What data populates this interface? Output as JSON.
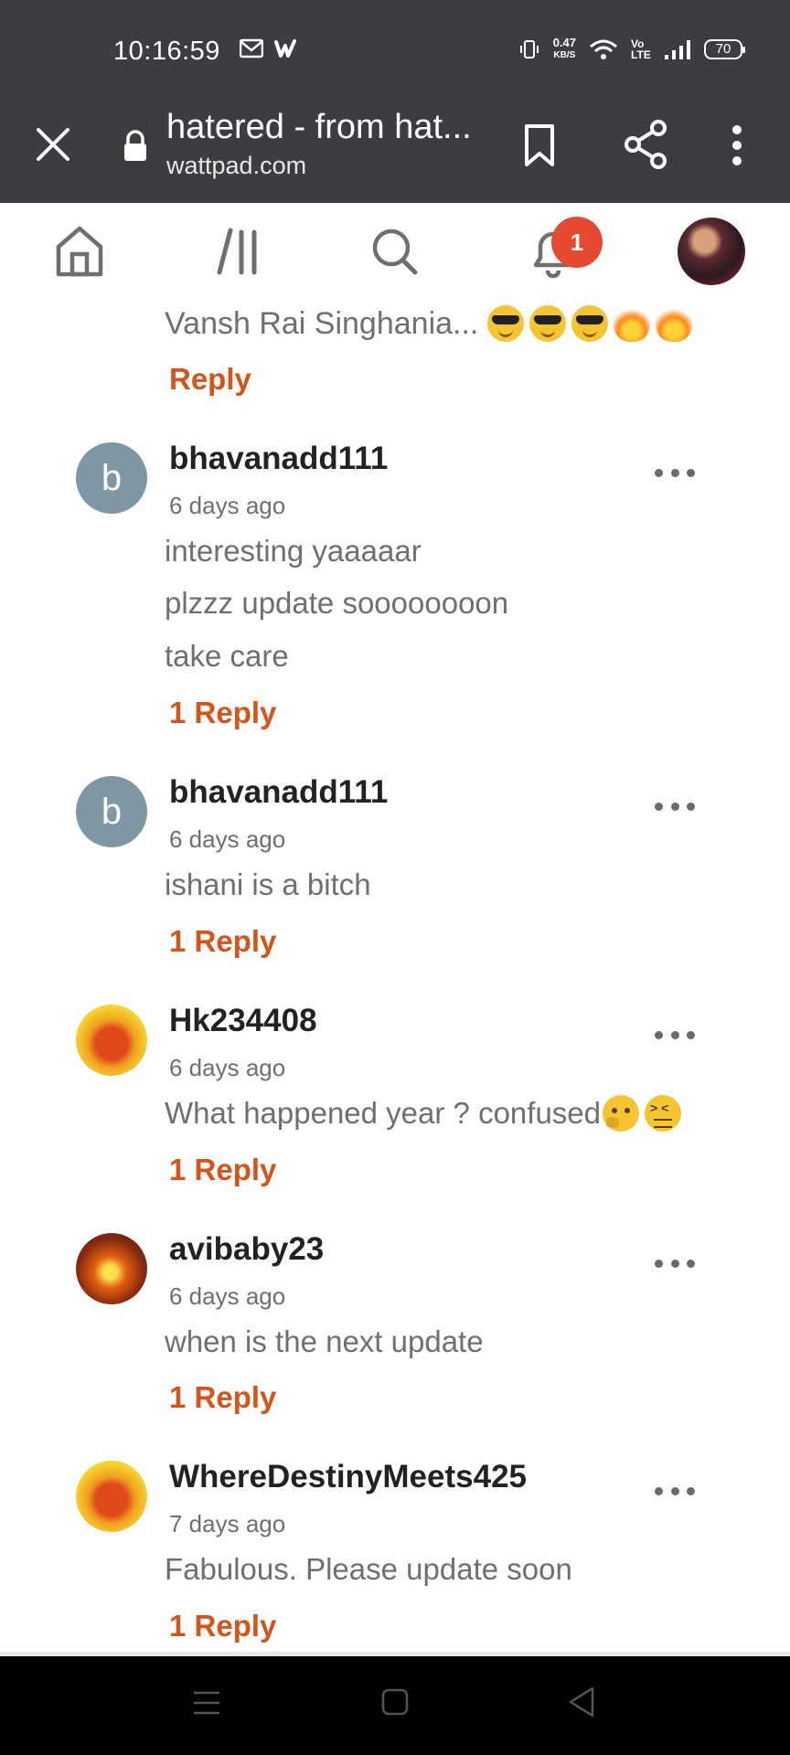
{
  "status_bar": {
    "time": "10:16:59",
    "net_speed_value": "0.47",
    "net_speed_unit": "KB/S",
    "volte": "Vo LTE",
    "battery": "70"
  },
  "browser": {
    "title": "hatered - from hat...",
    "url": "wattpad.com"
  },
  "app_nav": {
    "notification_count": "1"
  },
  "partial_comment": {
    "text": "Vansh Rai Singhania...",
    "reply_label": "Reply"
  },
  "comments": [
    {
      "username": "bhavanadd111",
      "avatar_letter": "b",
      "time": "6 days ago",
      "lines": [
        "interesting yaaaaar",
        "plzzz  update soooooooon",
        "take care"
      ],
      "reply_label": "1 Reply"
    },
    {
      "username": "bhavanadd111",
      "avatar_letter": "b",
      "time": "6 days ago",
      "lines": [
        "ishani  is  a bitch"
      ],
      "reply_label": "1 Reply"
    },
    {
      "username": "Hk234408",
      "avatar_letter": "",
      "time": "6 days ago",
      "lines": [
        "What happened year ? confused"
      ],
      "reply_label": "1 Reply"
    },
    {
      "username": "avibaby23",
      "avatar_letter": "",
      "time": "6 days ago",
      "lines": [
        "when is the next update"
      ],
      "reply_label": "1 Reply"
    },
    {
      "username": "WhereDestinyMeets425",
      "avatar_letter": "",
      "time": "7 days ago",
      "lines": [
        "Fabulous. Please update soon"
      ],
      "reply_label": "1 Reply"
    }
  ],
  "colors": {
    "accent_reply": "#d4541a",
    "chrome_bg": "#3c3d40",
    "badge": "#e5492f"
  }
}
